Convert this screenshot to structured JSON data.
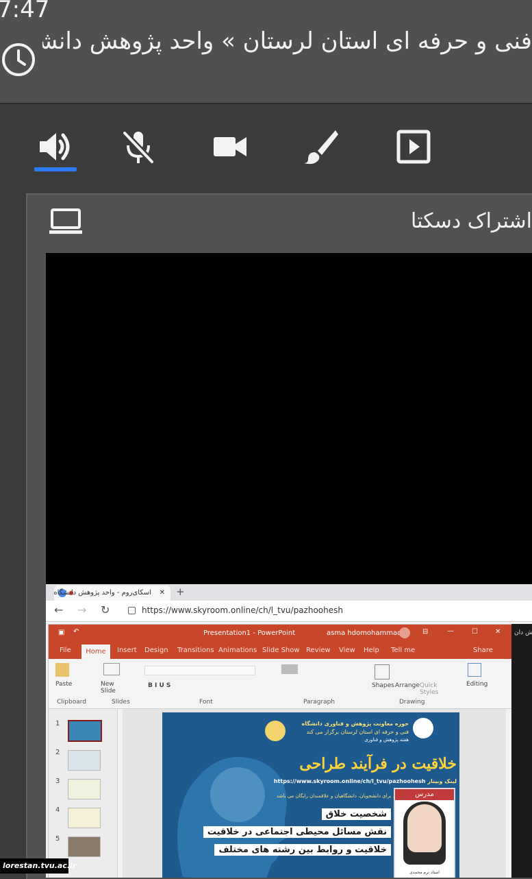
{
  "status_bar": {
    "time": "7:47"
  },
  "room": {
    "title": "فنی و حرفه ای استان لرستان » واحد پژوهش دانشگاه"
  },
  "toolbar": {
    "tabs": [
      {
        "id": "audio",
        "icon": "speaker-icon",
        "active": true
      },
      {
        "id": "mic",
        "icon": "mic-off-icon",
        "active": false
      },
      {
        "id": "camera",
        "icon": "video-camera-icon",
        "active": false
      },
      {
        "id": "whiteboard",
        "icon": "brush-icon",
        "active": false
      },
      {
        "id": "media",
        "icon": "play-box-icon",
        "active": false
      }
    ],
    "accent": "#2d7bf6"
  },
  "panel": {
    "title": "اشتراک دسکتاپ استاد محمدی",
    "icon": "laptop-icon"
  },
  "browser": {
    "tab_title": "اسکای‌روم - واحد پژوهش دانشگاه",
    "url": "https://www.skyroom.online/ch/l_tvu/pazhoohesh"
  },
  "ppt": {
    "title": "Presentation1 - PowerPoint",
    "user": "asma hdomohammadi",
    "share": "Share",
    "tabs": [
      "File",
      "Home",
      "Insert",
      "Design",
      "Transitions",
      "Animations",
      "Slide Show",
      "Review",
      "View",
      "Help",
      "Tell me"
    ],
    "groups": [
      "Clipboard",
      "Slides",
      "Font",
      "Paragraph",
      "Drawing"
    ],
    "buttons": {
      "paste": "Paste",
      "new_slide": "New Slide",
      "shapes": "Shapes",
      "arrange": "Arrange",
      "quick_styles": "Quick Styles",
      "editing": "Editing"
    },
    "thumb_numbers": [
      "1",
      "2",
      "3",
      "4",
      "5"
    ],
    "accent": "#c8472b"
  },
  "slide": {
    "header_line1": "حوزه معاونت پژوهش و فناوری دانشگاه",
    "header_line2": "فنی و حرفه ای استان لرستان برگزار می کند",
    "header_line3": "هفته پژوهش و فناوری",
    "title": "خلاقیت در فرآیند طراحی",
    "link_label": "لینک وبینار",
    "link": "https://www.skyroom.online/ch/l_tvu/pazhoohesh",
    "intro": "ورود برای دانشجویان، دانشگاهیان و علاقمندان رایگان می باشد",
    "bullets": [
      "شخصیت خلاق",
      "نقش مسائل محیطی اجتماعی در خلاقیت",
      "خلاقیت و روابط بین رشته های مختلف"
    ],
    "teacher_label": "مدرس",
    "teacher_name": "استاد نرم محمدی"
  },
  "side_window": {
    "title": "پژوهش دان"
  },
  "watermark": "lorestan.tvu.ac.ir"
}
